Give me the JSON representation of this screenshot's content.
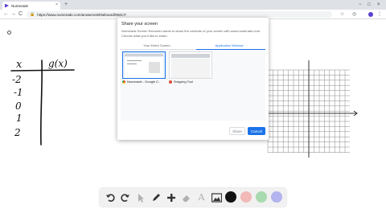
{
  "browser": {
    "tab_title": "Numerade",
    "tab_close": "×",
    "new_tab": "+",
    "window_controls": [
      "−",
      "□",
      "×"
    ],
    "nav": {
      "back": "←",
      "forward": "→",
      "reload": "C"
    },
    "url": "https://www.numerade.com/answers/whiteboard/09417/",
    "toolbar_icons": [
      "☆",
      "◎",
      "⋮"
    ],
    "accent": "#5b3fd3"
  },
  "whiteboard": {
    "table_header": [
      "x",
      "g(x)"
    ],
    "x_values": [
      "-2",
      "-1",
      "0",
      "1",
      "2"
    ]
  },
  "dialog": {
    "title": "Share your screen",
    "description": "Numerade Screen Recorder wants to share the contents of your screen with www.numerade.com. Choose what you'd like to share.",
    "tabs": [
      "Your Entire Screen",
      "Application Window"
    ],
    "active_tab": "Application Window",
    "windows": [
      {
        "label": "Numerade - Google C...",
        "icon": "chrome-icon",
        "selected": true
      },
      {
        "label": "Snipping Tool",
        "icon": "snipping-tool-icon",
        "selected": false
      }
    ],
    "share_label": "Share",
    "cancel_label": "Cancel",
    "accent": "#1a73e8"
  },
  "palette": {
    "tools": [
      "undo-icon",
      "redo-icon",
      "pointer-icon",
      "pen-icon",
      "add-icon",
      "eraser-icon",
      "text-icon",
      "image-icon"
    ],
    "colors": [
      "#111111",
      "#f3b8b8",
      "#a9d9b0",
      "#b3b3f0"
    ]
  }
}
